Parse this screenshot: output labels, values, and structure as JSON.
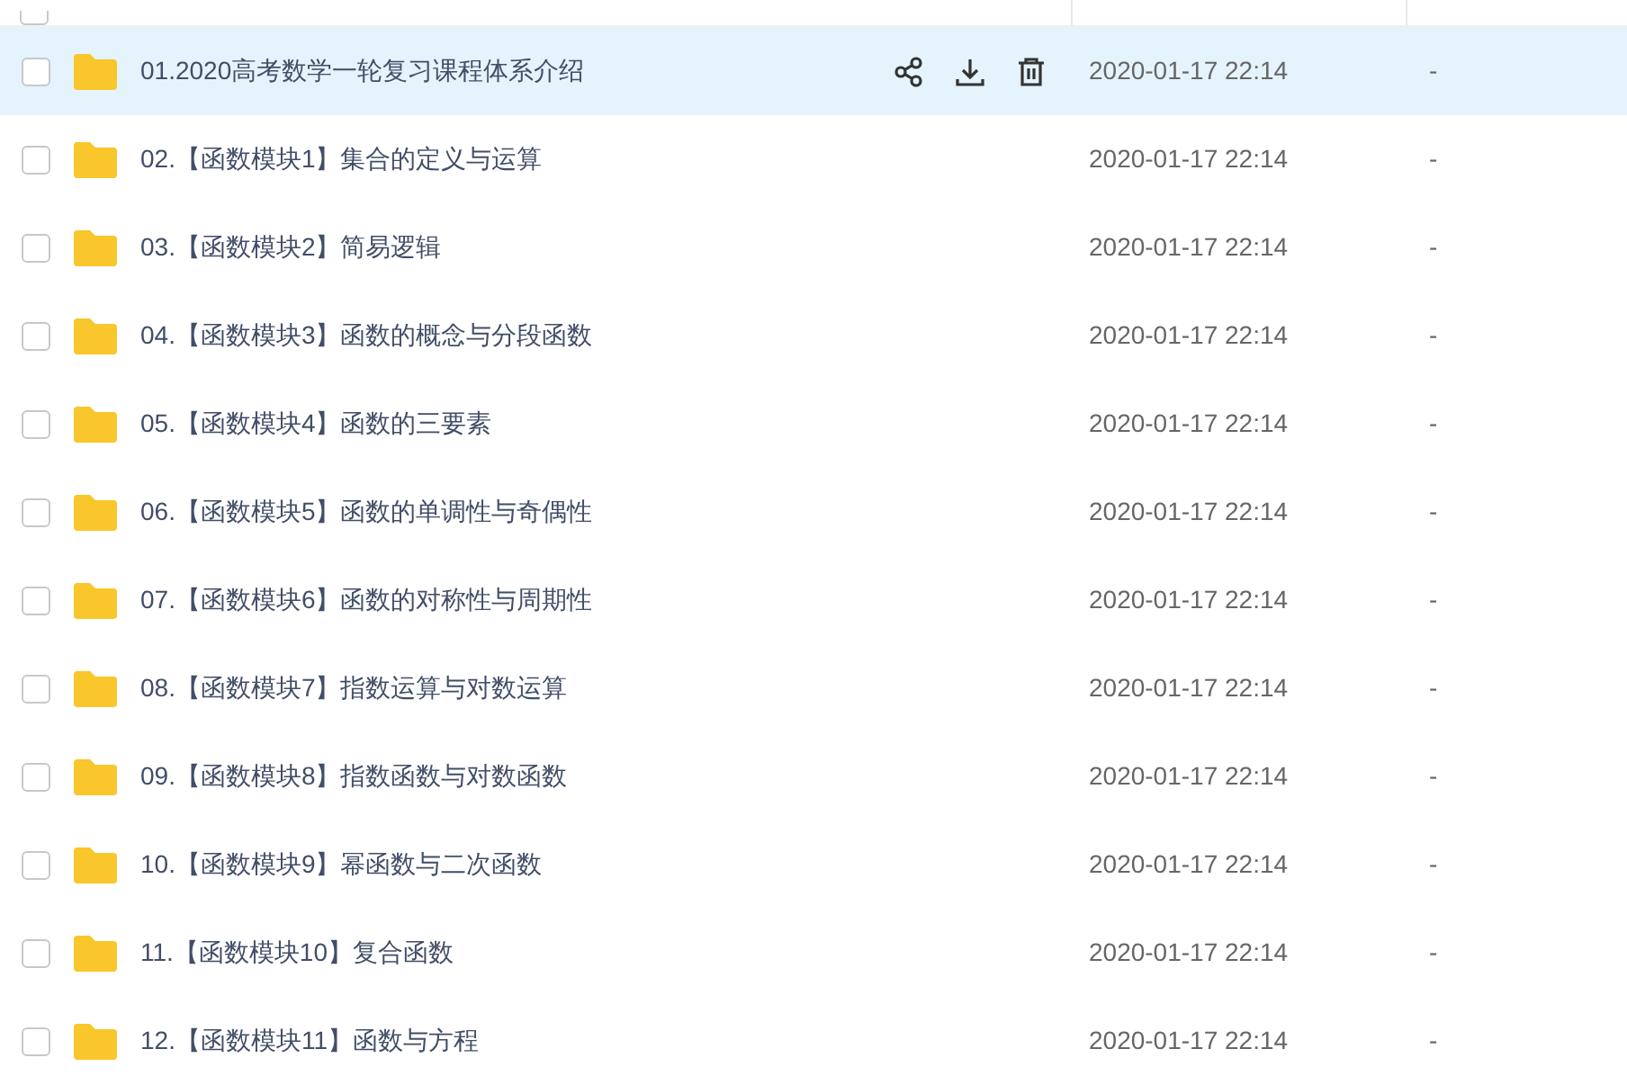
{
  "select_all": {
    "checked": false
  },
  "rows": [
    {
      "name": "01.2020高考数学一轮复习课程体系介绍",
      "modified": "2020-01-17 22:14",
      "size": "-",
      "selected": true,
      "checked": false
    },
    {
      "name": "02.【函数模块1】集合的定义与运算",
      "modified": "2020-01-17 22:14",
      "size": "-",
      "selected": false,
      "checked": false
    },
    {
      "name": "03.【函数模块2】简易逻辑",
      "modified": "2020-01-17 22:14",
      "size": "-",
      "selected": false,
      "checked": false
    },
    {
      "name": "04.【函数模块3】函数的概念与分段函数",
      "modified": "2020-01-17 22:14",
      "size": "-",
      "selected": false,
      "checked": false
    },
    {
      "name": "05.【函数模块4】函数的三要素",
      "modified": "2020-01-17 22:14",
      "size": "-",
      "selected": false,
      "checked": false
    },
    {
      "name": "06.【函数模块5】函数的单调性与奇偶性",
      "modified": "2020-01-17 22:14",
      "size": "-",
      "selected": false,
      "checked": false
    },
    {
      "name": "07.【函数模块6】函数的对称性与周期性",
      "modified": "2020-01-17 22:14",
      "size": "-",
      "selected": false,
      "checked": false
    },
    {
      "name": "08.【函数模块7】指数运算与对数运算",
      "modified": "2020-01-17 22:14",
      "size": "-",
      "selected": false,
      "checked": false
    },
    {
      "name": "09.【函数模块8】指数函数与对数函数",
      "modified": "2020-01-17 22:14",
      "size": "-",
      "selected": false,
      "checked": false
    },
    {
      "name": "10.【函数模块9】幂函数与二次函数",
      "modified": "2020-01-17 22:14",
      "size": "-",
      "selected": false,
      "checked": false
    },
    {
      "name": "11.【函数模块10】复合函数",
      "modified": "2020-01-17 22:14",
      "size": "-",
      "selected": false,
      "checked": false
    },
    {
      "name": "12.【函数模块11】函数与方程",
      "modified": "2020-01-17 22:14",
      "size": "-",
      "selected": false,
      "checked": false
    }
  ]
}
